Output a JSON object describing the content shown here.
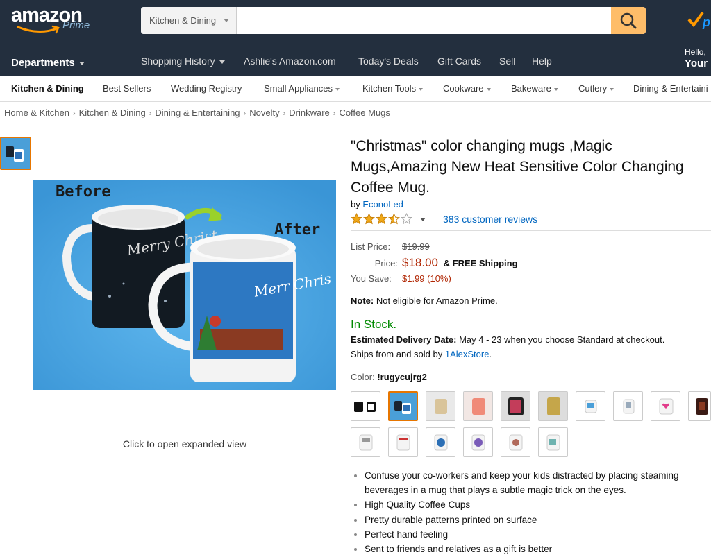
{
  "header": {
    "logo_text": "amazon",
    "logo_sub": "Prime",
    "search_category": "Kitchen & Dining",
    "search_value": "",
    "departments_label": "Departments",
    "nav_links": [
      "Shopping History",
      "Ashlie's Amazon.com",
      "Today's Deals",
      "Gift Cards",
      "Sell",
      "Help"
    ],
    "greeting": "Hello,",
    "account_label": "Your"
  },
  "subnav": {
    "items": [
      "Kitchen & Dining",
      "Best Sellers",
      "Wedding Registry",
      "Small Appliances",
      "Kitchen Tools",
      "Cookware",
      "Bakeware",
      "Cutlery",
      "Dining & Entertaini"
    ]
  },
  "breadcrumb": [
    "Home & Kitchen",
    "Kitchen & Dining",
    "Dining & Entertaining",
    "Novelty",
    "Drinkware",
    "Coffee Mugs"
  ],
  "image": {
    "before_label": "Before",
    "after_label": "After",
    "mug_text_1": "Merry Christ",
    "mug_text_2": "Merr Chris",
    "expand_label": "Click to open expanded view"
  },
  "product": {
    "title": "\"Christmas\" color changing mugs ,Magic Mugs,Amazing New Heat Sensitive Color Changing Coffee Mug.",
    "by_label": "by",
    "brand": "EconoLed",
    "rating": 3.5,
    "rating_max": 5,
    "reviews": "383 customer reviews",
    "list_price_label": "List Price:",
    "list_price": "$19.99",
    "price_label": "Price:",
    "price": "$18.00",
    "shipping": "& FREE Shipping",
    "save_label": "You Save:",
    "save_value": "$1.99 (10%)",
    "note_label": "Note:",
    "note_text": "Not eligible for Amazon Prime.",
    "stock": "In Stock.",
    "delivery_label": "Estimated Delivery Date:",
    "delivery_text": "May 4 - 23 when you choose Standard at checkout.",
    "ships_text": "Ships from and sold by",
    "seller": "1AlexStore",
    "color_label": "Color:",
    "color_value": "!rugycujrg2",
    "bullets": [
      "Confuse your co-workers and keep your kids distracted by placing steaming beverages in a mug that plays a subtle magic trick on the eyes.",
      "High Quality Coffee Cups",
      "Pretty durable patterns printed on surface",
      "Perfect hand feeling",
      "Sent to friends and relatives as a gift is better"
    ]
  },
  "colors": {
    "header_bg": "#232f3e",
    "search_button": "#febd69",
    "price_red": "#b12704",
    "stock_green": "#008a00",
    "link_blue": "#0066c0",
    "selected_orange": "#e77600"
  }
}
